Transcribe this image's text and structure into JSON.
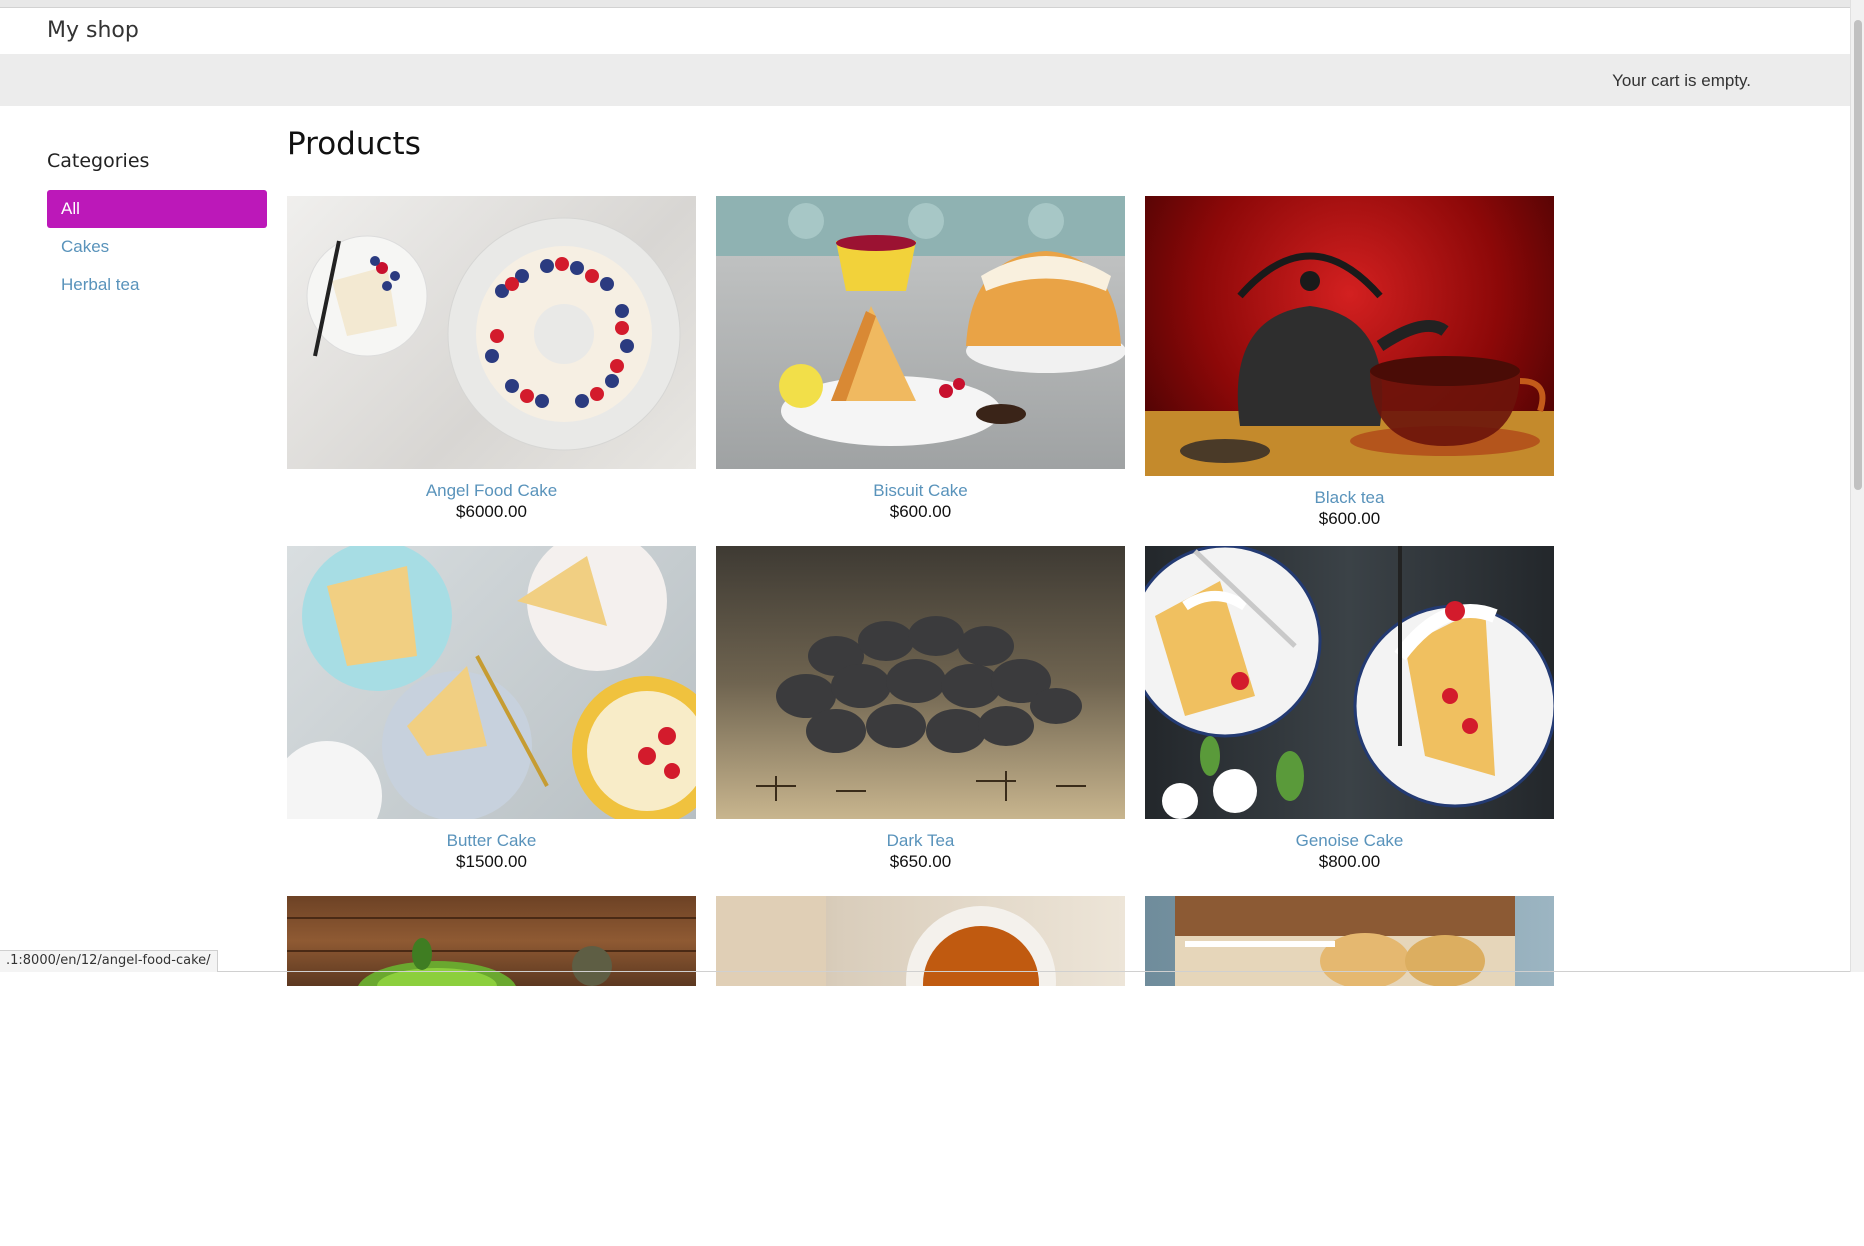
{
  "header": {
    "logo": "My shop",
    "cart_status": "Your cart is empty."
  },
  "sidebar": {
    "title": "Categories",
    "items": [
      {
        "label": "All",
        "selected": true
      },
      {
        "label": "Cakes",
        "selected": false
      },
      {
        "label": "Herbal tea",
        "selected": false
      }
    ]
  },
  "main": {
    "title": "Products"
  },
  "products": [
    {
      "name": "Angel Food Cake",
      "price": "$6000.00",
      "image_icon": "angel-food-cake-image"
    },
    {
      "name": "Biscuit Cake",
      "price": "$600.00",
      "image_icon": "biscuit-cake-image"
    },
    {
      "name": "Black tea",
      "price": "$600.00",
      "image_icon": "black-tea-image"
    },
    {
      "name": "Butter Cake",
      "price": "$1500.00",
      "image_icon": "butter-cake-image"
    },
    {
      "name": "Dark Tea",
      "price": "$650.00",
      "image_icon": "dark-tea-image"
    },
    {
      "name": "Genoise Cake",
      "price": "$800.00",
      "image_icon": "genoise-cake-image"
    }
  ],
  "status_bar": {
    "url": ".1:8000/en/12/angel-food-cake/"
  },
  "colors": {
    "accent": "#bc18b9",
    "link": "#5993bb",
    "subheader_bg": "#ececec"
  }
}
